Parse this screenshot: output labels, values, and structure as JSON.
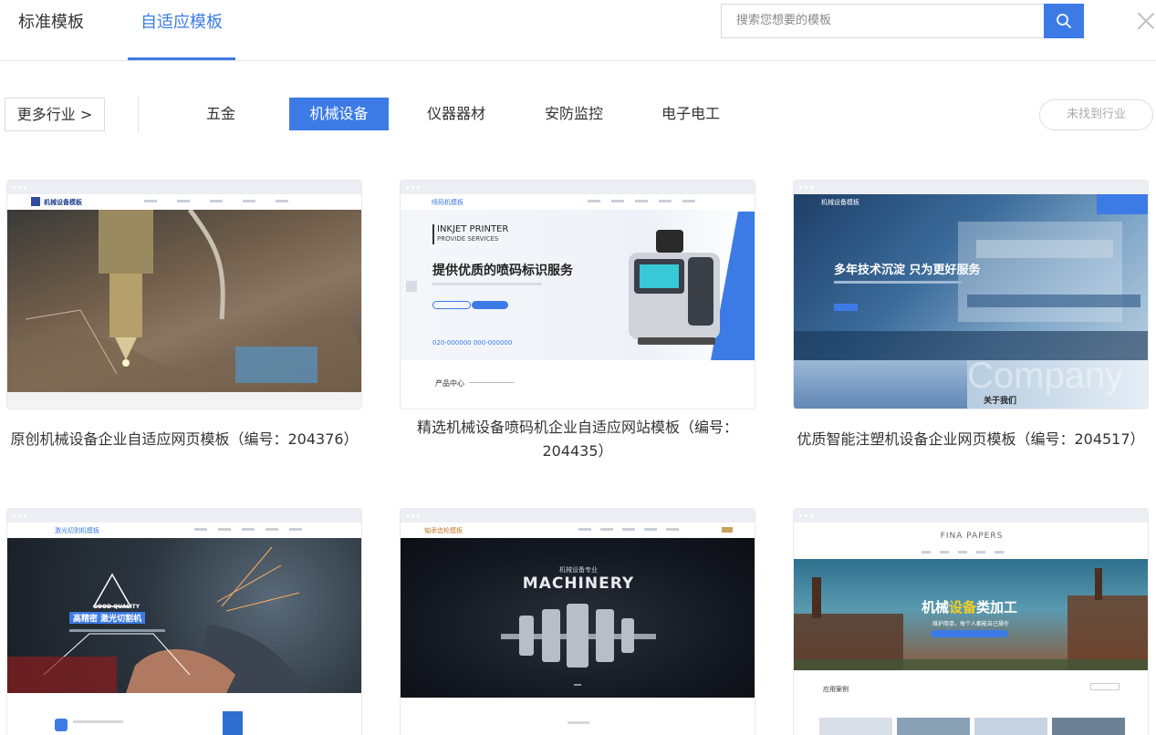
{
  "header": {
    "tabs": [
      "标准模板",
      "自适应模板"
    ],
    "search_placeholder": "搜索您想要的模板"
  },
  "filter": {
    "more_label": "更多行业 >",
    "industries": [
      "五金",
      "机械设备",
      "仪器器材",
      "安防监控",
      "电子电工"
    ],
    "active_industry": "机械设备",
    "not_found_label": "未找到行业"
  },
  "cards": [
    {
      "caption": "原创机械设备企业自适应网页模板（编号：204376）",
      "preview": {
        "logo": "机械设备模板"
      }
    },
    {
      "caption": "精选机械设备喷码机企业自适应网站模板（编号：204435）",
      "preview": {
        "logo": "喷码机模板",
        "line1": "INKJET PRINTER",
        "line2": "PROVIDE SERVICES",
        "headline": "提供优质的喷码标识服务",
        "phone": "020-000000 000-000000",
        "section": "产品中心"
      }
    },
    {
      "caption": "优质智能注塑机设备企业网页模板（编号：204517）",
      "preview": {
        "logo": "机械设备模板",
        "headline": "多年技术沉淀 只为更好服务",
        "about": "关于我们",
        "watermark": "Company"
      }
    },
    {
      "caption": "",
      "preview": {
        "logo": "激光切割机模板",
        "tag": "GOOD QUALITY",
        "headline": "高精密 激光切割机"
      }
    },
    {
      "caption": "",
      "preview": {
        "logo": "轴承齿轮模板",
        "sub": "机械设备专业",
        "headline": "MACHINERY"
      }
    },
    {
      "caption": "",
      "preview": {
        "logo": "FINA PAPERS",
        "headline_a": "机械",
        "headline_b": "设备",
        "headline_c": "类加工",
        "sub": "维护简单，每个人都能自己操作",
        "section": "应用案例"
      }
    }
  ],
  "colors": {
    "accent": "#3c7be6"
  }
}
